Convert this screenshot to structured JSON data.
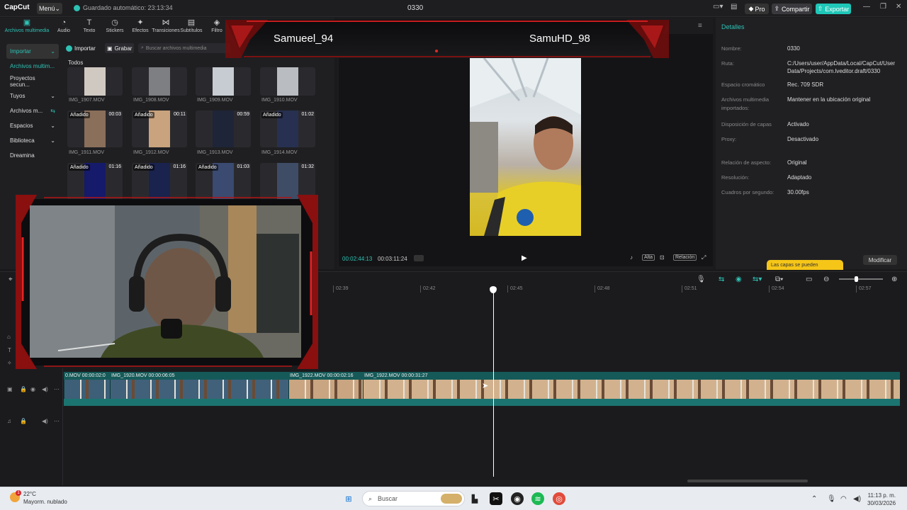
{
  "titlebar": {
    "logo": "CapCut",
    "menu": "Menú",
    "saved": "Guardado automático: 23:13:34",
    "project": "0330",
    "pro": "Pro",
    "share": "Compartir",
    "export": "Exportar"
  },
  "tools": [
    {
      "label": "Archivos multimedia",
      "icon": "▣"
    },
    {
      "label": "Audio",
      "icon": "◔"
    },
    {
      "label": "Texto",
      "icon": "T"
    },
    {
      "label": "Stickers",
      "icon": "◷"
    },
    {
      "label": "Efectos",
      "icon": "✦"
    },
    {
      "label": "Transiciones",
      "icon": "⋈"
    },
    {
      "label": "Subtítulos",
      "icon": "▤"
    },
    {
      "label": "Filtro",
      "icon": "◈"
    }
  ],
  "sidebar": [
    {
      "label": "Importar"
    },
    {
      "label": "Archivos multim..."
    },
    {
      "label": "Proyectos secun..."
    },
    {
      "label": "Tuyos"
    },
    {
      "label": "Archivos m..."
    },
    {
      "label": "Espacios"
    },
    {
      "label": "Biblioteca"
    },
    {
      "label": "Dreamina"
    }
  ],
  "media": {
    "import_btn": "Importar",
    "record_btn": "Grabar",
    "search_placeholder": "Buscar archivos multimedia",
    "section": "Todos",
    "items": [
      {
        "name": "IMG_1907.MOV",
        "tag": "",
        "dur": ""
      },
      {
        "name": "IMG_1908.MOV",
        "tag": "",
        "dur": ""
      },
      {
        "name": "IMG_1909.MOV",
        "tag": "",
        "dur": ""
      },
      {
        "name": "IMG_1910.MOV",
        "tag": "",
        "dur": ""
      },
      {
        "name": "IMG_1911.MOV",
        "tag": "Añadido",
        "dur": "00:03"
      },
      {
        "name": "IMG_1912.MOV",
        "tag": "Añadido",
        "dur": "00:11"
      },
      {
        "name": "IMG_1913.MOV",
        "tag": "",
        "dur": "00:59"
      },
      {
        "name": "IMG_1914.MOV",
        "tag": "Añadido",
        "dur": "01:02"
      },
      {
        "name": "",
        "tag": "Añadido",
        "dur": "01:16"
      },
      {
        "name": "",
        "tag": "Añadido",
        "dur": "01:16"
      },
      {
        "name": "",
        "tag": "Añadido",
        "dur": "01:03"
      },
      {
        "name": "",
        "tag": "",
        "dur": "01:32"
      }
    ]
  },
  "overlay": {
    "player1": "Samueel_94",
    "player2": "SamuHD_98"
  },
  "player": {
    "current": "00:02:44:13",
    "total": "00:03:11:24",
    "ratio": "Relación",
    "quality": "Alta"
  },
  "details": {
    "title": "Detalles",
    "rows": [
      {
        "label": "Nombre:",
        "value": "0330"
      },
      {
        "label": "Ruta:",
        "value": "C:/Users/user/AppData/Local/CapCut/User Data/Projects/com.lveditor.draft/0330"
      },
      {
        "label": "Espacio cromático",
        "value": "Rec. 709 SDR"
      },
      {
        "label": "Archivos multimedia importados:",
        "value": "Mantener en la ubicación original"
      },
      {
        "label": "Disposición de capas",
        "value": "Activado"
      },
      {
        "label": "Proxy:",
        "value": "Desactivado"
      },
      {
        "label": "Relación de aspecto:",
        "value": "Original"
      },
      {
        "label": "Resolución:",
        "value": "Adaptado"
      },
      {
        "label": "Cuadros por segundo:",
        "value": "30.00fps"
      }
    ],
    "tooltip": "Las capas se pueden",
    "modify": "Modificar"
  },
  "timeline": {
    "ticks": [
      "02:39",
      "02:42",
      "02:45",
      "02:48",
      "02:51",
      "02:54",
      "02:57"
    ],
    "clips": [
      {
        "label": "0.MOV   00:00:02:0"
      },
      {
        "label": "IMG_1920.MOV   00:00:06:05"
      },
      {
        "label": "IMG_1922.MOV   00:00:02:16"
      },
      {
        "label": "IMG_1922.MOV   00:00:31:27"
      }
    ]
  },
  "taskbar": {
    "temp": "22°C",
    "weather": "Mayorm. nublado",
    "search": "Buscar",
    "time": "11:13 p. m.",
    "date": "30/03/2026"
  }
}
